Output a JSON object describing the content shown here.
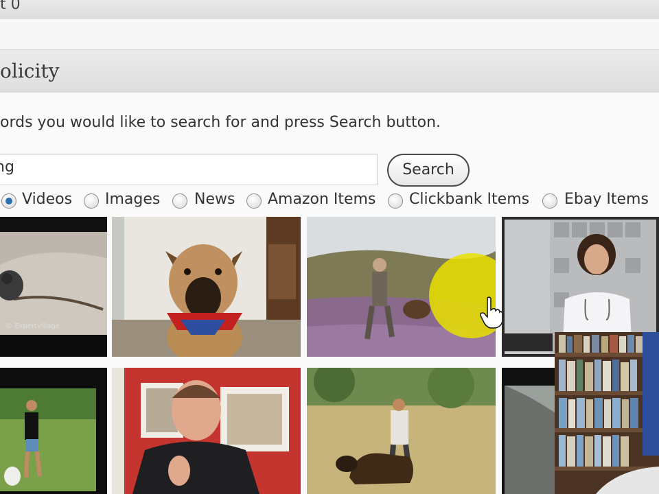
{
  "top_bar": {
    "text": "t 0"
  },
  "panel": {
    "title": "olicity"
  },
  "instructions": "ords you would like to search for and press Search button.",
  "search": {
    "value": "ng",
    "button_label": "Search"
  },
  "search_types": [
    {
      "label": "Videos",
      "selected": true
    },
    {
      "label": "Images",
      "selected": false
    },
    {
      "label": "News",
      "selected": false
    },
    {
      "label": "Amazon Items",
      "selected": false
    },
    {
      "label": "Clickbank Items",
      "selected": false
    },
    {
      "label": "Ebay Items",
      "selected": false
    }
  ],
  "results": {
    "row1": [
      {
        "name": "video-thumbnail-dog-on-rocks",
        "caption": "© Expertvillage"
      },
      {
        "name": "video-thumbnail-dog-with-bandana"
      },
      {
        "name": "video-thumbnail-man-training-dog-field"
      },
      {
        "name": "video-thumbnail-veterinarian"
      }
    ],
    "row2": [
      {
        "name": "video-thumbnail-woman-with-dog-grass"
      },
      {
        "name": "video-thumbnail-man-talking"
      },
      {
        "name": "video-thumbnail-german-shepherd-training"
      },
      {
        "name": "video-thumbnail-partial"
      }
    ]
  },
  "overlay": {
    "name": "webcam-overlay-bookshelf"
  },
  "colors": {
    "accent_radio": "#2a6fb0",
    "cursor_highlight": "#f2e800"
  }
}
